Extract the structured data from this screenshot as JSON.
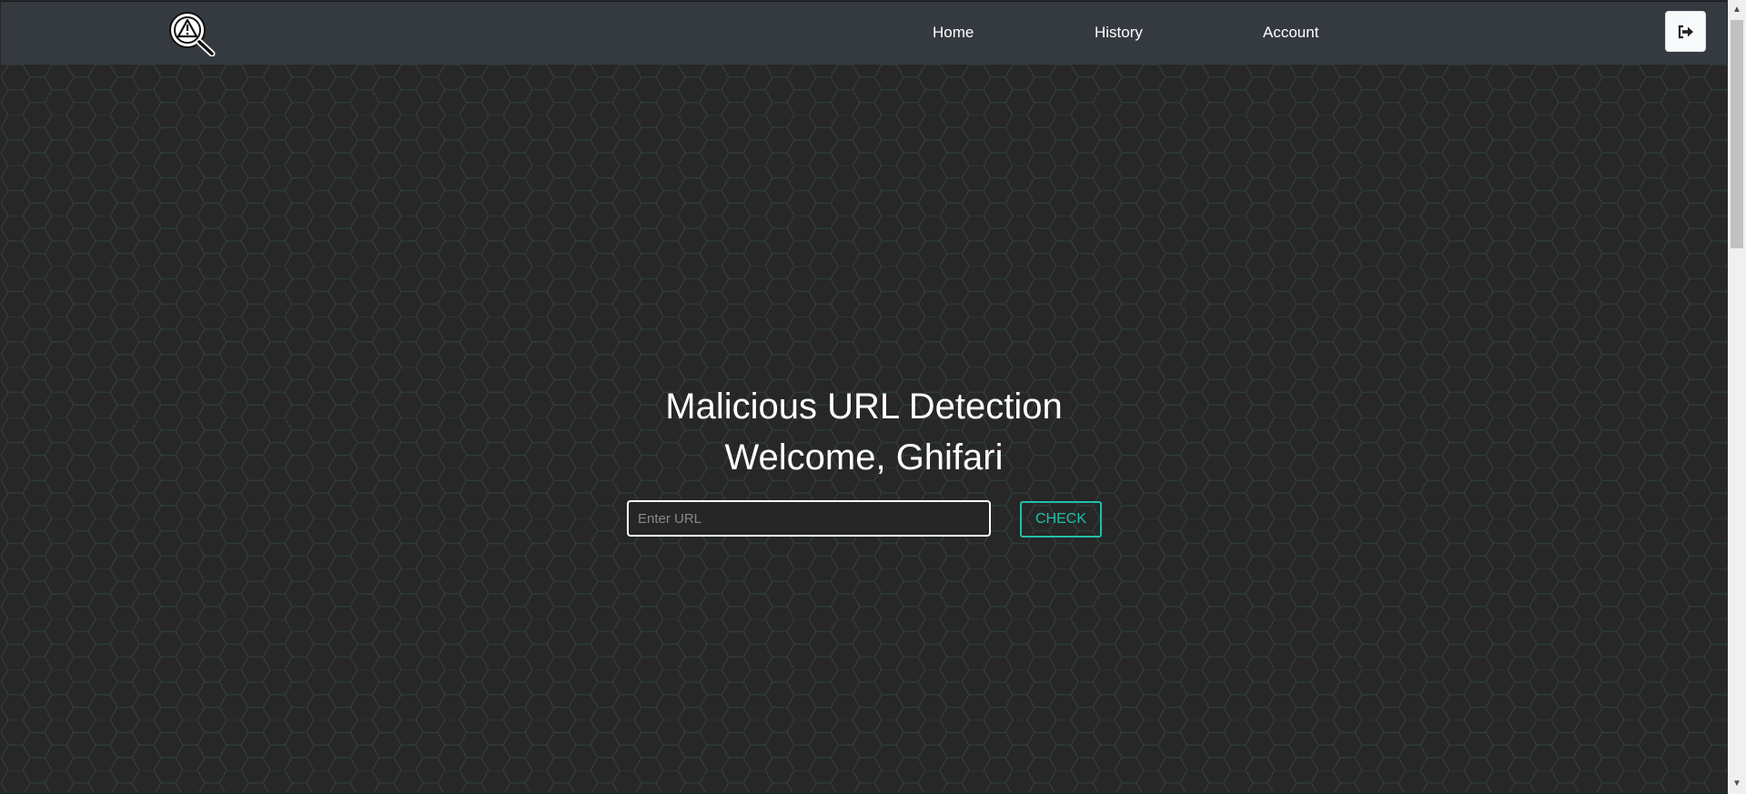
{
  "nav": {
    "logo_icon": "warning-magnifier-icon",
    "links": [
      {
        "label": "Home"
      },
      {
        "label": "History"
      },
      {
        "label": "Account"
      }
    ],
    "logout_icon": "sign-out-icon"
  },
  "hero": {
    "title": "Malicious URL Detection",
    "welcome": "Welcome, Ghifari",
    "url_input": {
      "value": "",
      "placeholder": "Enter URL"
    },
    "check_label": "CHECK"
  },
  "colors": {
    "navbar": "#343a40",
    "background": "#272727",
    "hex_stroke": "#2f3d3b",
    "accent": "#20c0a8"
  }
}
